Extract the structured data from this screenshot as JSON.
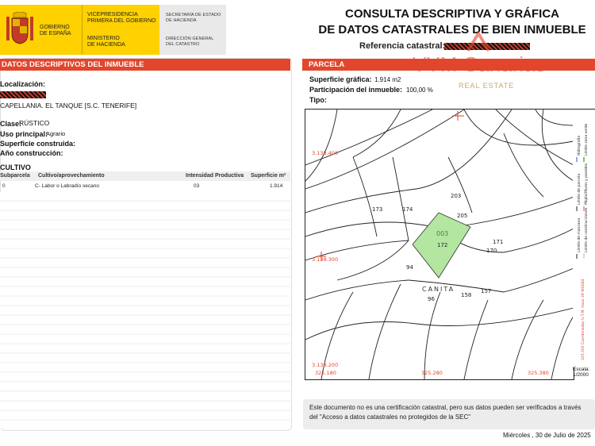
{
  "header": {
    "gov_lines": [
      "GOBIERNO",
      "DE ESPAÑA"
    ],
    "vice_lines_1": [
      "VICEPRESIDENCIA",
      "PRIMERA DEL GOBIERNO"
    ],
    "vice_lines_2": [
      "MINISTERIO",
      "DE HACIENDA"
    ],
    "sec_lines_1": [
      "SECRETARÍA DE ESTADO",
      "DE HACIENDA"
    ],
    "sec_lines_2": [
      "DIRECCIÓN GENERAL",
      "DEL CATASTRO"
    ],
    "title_line1": "CONSULTA DESCRIPTIVA Y GRÁFICA",
    "title_line2": "DE DATOS CATASTRALES DE BIEN INMUEBLE",
    "ref_label": "Referencia catastral:"
  },
  "left": {
    "header": "DATOS DESCRIPTIVOS DEL INMUEBLE",
    "localizacion_label": "Localización:",
    "localizacion_value": "CAPELLANIA. EL TANQUE [S.C. TENERIFE]",
    "clase_label": "Clase:",
    "clase_value": "RÚSTICO",
    "uso_label": "Uso principal:",
    "uso_value": "Agrario",
    "superficie_label": "Superficie construida:",
    "anio_label": "Año construcción:",
    "cultivo_label": "CULTIVO",
    "table": {
      "headers": [
        "Subparcela",
        "Cultivo/aprovechamiento",
        "Intensidad Productiva",
        "Superficie m²"
      ],
      "rows": [
        [
          "0",
          "C- Labor o Labradío secano",
          "03",
          "1.914"
        ]
      ]
    }
  },
  "right": {
    "header": "PARCELA",
    "sup_label": "Superficie gráfica:",
    "sup_value": "1.914 m2",
    "part_label": "Participación del inmueble:",
    "part_value": "100,00 %",
    "tipo_label": "Tipo:",
    "watermark": "VYM Canarias",
    "watermark_sub": "REAL ESTATE"
  },
  "map": {
    "parcel_id": "003",
    "parcel_number": "172",
    "place_name": "CANITA",
    "lot_numbers": [
      "173",
      "174",
      "203",
      "205",
      "171",
      "170",
      "94",
      "96",
      "158",
      "157"
    ],
    "coords_y": [
      "3.138.400",
      "3.138.300",
      "3.138.200"
    ],
    "coords_x": [
      "325.180",
      "325.280",
      "325.380"
    ],
    "legend_labels": [
      "Hidrografía",
      "Límite zona verde",
      "Límite de parcela",
      "Mojón/Muros y paredes",
      "Límite de manzana",
      "Límite de construcciones",
      "325.300 Coordenadas U.T.M. Huso 28 WGS84"
    ],
    "scale_label": "Escala:",
    "scale_value": "1/2000",
    "colors": {
      "parcel_fill": "#b3e6a1",
      "coord_red": "#e2462c",
      "header_red": "#e2462c"
    }
  },
  "notice": "Este documento no es una certificación catastral, pero sus datos pueden ser verificados a través del \"Acceso a datos catastrales no protegidos de la SEC\"",
  "date": "Miércoles , 30 de Julio de 2025"
}
